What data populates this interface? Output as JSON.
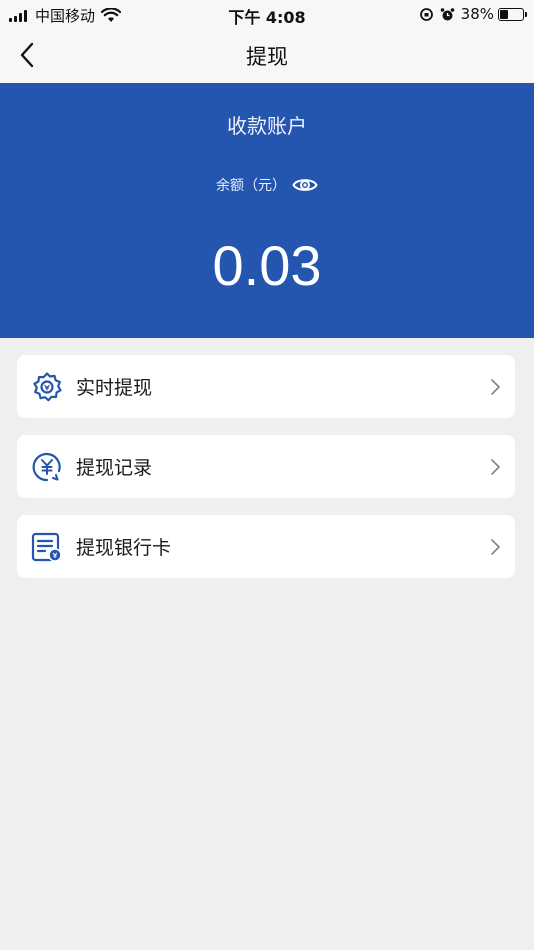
{
  "status_bar": {
    "carrier": "中国移动",
    "time": "下午 4:08",
    "battery": "38%",
    "battery_level": 0.38
  },
  "nav": {
    "title": "提现",
    "back_icon": "chevron-left-icon"
  },
  "account": {
    "title": "收款账户",
    "balance_label": "余额（元）",
    "balance_value": "0.03",
    "eye_icon": "eye-icon",
    "panel_color": "#2456b0"
  },
  "menu": [
    {
      "label": "实时提现",
      "icon": "gear-yuan-icon"
    },
    {
      "label": "提现记录",
      "icon": "yuan-history-icon"
    },
    {
      "label": "提现银行卡",
      "icon": "bank-card-icon"
    }
  ],
  "accent_color": "#2456b0"
}
